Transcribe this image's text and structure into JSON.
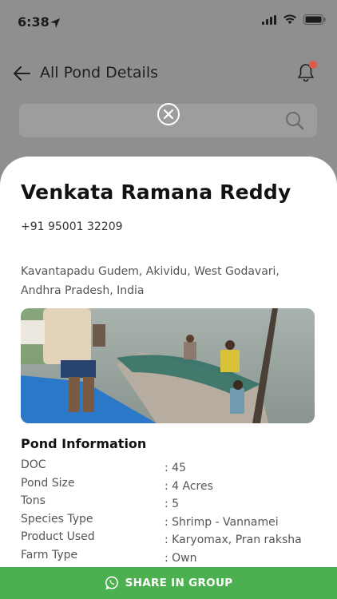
{
  "status_bar": {
    "time": "6:38"
  },
  "header": {
    "title": "All Pond Details"
  },
  "owner": {
    "name": "Venkata Ramana Reddy",
    "phone": "+91 95001 32209",
    "address_line1": "Kavantapadu Gudem, Akividu, West Godavari,",
    "address_line2": "Andhra Pradesh, India"
  },
  "pond_info": {
    "title": "Pond Information",
    "rows": [
      {
        "label": "DOC",
        "value": ": 45"
      },
      {
        "label": "Pond Size",
        "value": ": 4 Acres"
      },
      {
        "label": "Tons",
        "value": ": 5"
      },
      {
        "label": "Species Type",
        "value": ": Shrimp - Vannamei"
      },
      {
        "label": "Product Used",
        "value": ": Karyomax, Pran raksha"
      },
      {
        "label": "Farm Type",
        "value": ": Own"
      }
    ]
  },
  "share": {
    "label": "SHARE IN GROUP"
  },
  "colors": {
    "accent_green": "#4caf50",
    "notification_dot": "#e05a4a",
    "overlay_bg": "#8f8f8f"
  },
  "icons": [
    "location-arrow-icon",
    "signal-icon",
    "wifi-icon",
    "battery-icon",
    "back-arrow-icon",
    "bell-icon",
    "search-icon",
    "close-icon",
    "whatsapp-icon"
  ]
}
